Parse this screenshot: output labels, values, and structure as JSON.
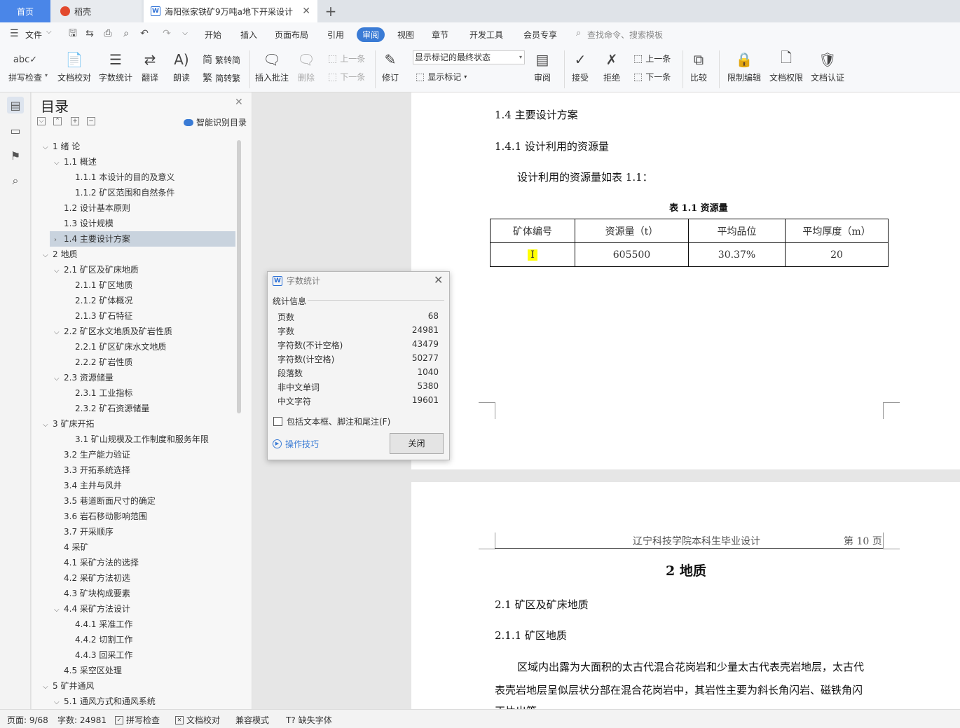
{
  "tabs": {
    "home": "首页",
    "daoke": "稻壳",
    "doc": "海阳张家铁矿9万吨a地下开采设计"
  },
  "menu": {
    "file": "文件",
    "items": [
      "开始",
      "插入",
      "页面布局",
      "引用",
      "审阅",
      "视图",
      "章节",
      "开发工具",
      "会员专享"
    ],
    "search": "查找命令、搜索模板"
  },
  "ribbon": {
    "spellcheck": "拼写检查",
    "doc_check": "文档校对",
    "word_count": "字数统计",
    "translate": "翻译",
    "read_aloud": "朗读",
    "trad": "繁转简",
    "simp": "简转繁",
    "insert_comment": "插入批注",
    "delete": "删除",
    "prev_comment": "上一条",
    "next_comment": "下一条",
    "revise": "修订",
    "markup_state": "显示标记的最终状态",
    "show_markup": "显示标记",
    "review": "审阅",
    "accept": "接受",
    "reject": "拒绝",
    "prev_change": "上一条",
    "next_change": "下一条",
    "compare": "比较",
    "restrict": "限制编辑",
    "permission": "文档权限",
    "certify": "文档认证"
  },
  "toc": {
    "title": "目录",
    "smart": "智能识别目录",
    "items": [
      {
        "label": "1  绪    论",
        "level": 0,
        "arrow": "down"
      },
      {
        "label": "1.1  概述",
        "level": 1,
        "arrow": "down"
      },
      {
        "label": "1.1.1  本设计的目的及意义",
        "level": 2,
        "arrow": ""
      },
      {
        "label": "1.1.2  矿区范围和自然条件",
        "level": 2,
        "arrow": ""
      },
      {
        "label": "1.2  设计基本原则",
        "level": 1,
        "arrow": ""
      },
      {
        "label": "1.3  设计规模",
        "level": 1,
        "arrow": ""
      },
      {
        "label": "1.4  主要设计方案",
        "level": 1,
        "arrow": "right",
        "selected": true
      },
      {
        "label": "2  地质",
        "level": 0,
        "arrow": "down"
      },
      {
        "label": "2.1  矿区及矿床地质",
        "level": 1,
        "arrow": "down"
      },
      {
        "label": "2.1.1  矿区地质",
        "level": 2,
        "arrow": ""
      },
      {
        "label": "2.1.2  矿体概况",
        "level": 2,
        "arrow": ""
      },
      {
        "label": "2.1.3  矿石特征",
        "level": 2,
        "arrow": ""
      },
      {
        "label": "2.2  矿区水文地质及矿岩性质",
        "level": 1,
        "arrow": "down"
      },
      {
        "label": "2.2.1  矿区矿床水文地质",
        "level": 2,
        "arrow": ""
      },
      {
        "label": "2.2.2  矿岩性质",
        "level": 2,
        "arrow": ""
      },
      {
        "label": "2.3  资源储量",
        "level": 1,
        "arrow": "down"
      },
      {
        "label": "2.3.1  工业指标",
        "level": 2,
        "arrow": ""
      },
      {
        "label": "2.3.2  矿石资源储量",
        "level": 2,
        "arrow": ""
      },
      {
        "label": "3  矿床开拓",
        "level": 0,
        "arrow": "down"
      },
      {
        "label": "3.1  矿山规模及工作制度和服务年限",
        "level": 2,
        "arrow": ""
      },
      {
        "label": "3.2  生产能力验证",
        "level": 1,
        "arrow": ""
      },
      {
        "label": "3.3  开拓系统选择",
        "level": 1,
        "arrow": ""
      },
      {
        "label": "3.4  主井与风井",
        "level": 1,
        "arrow": ""
      },
      {
        "label": "3.5  巷道断面尺寸的确定",
        "level": 1,
        "arrow": ""
      },
      {
        "label": "3.6  岩石移动影响范围",
        "level": 1,
        "arrow": ""
      },
      {
        "label": "3.7  开采顺序",
        "level": 1,
        "arrow": ""
      },
      {
        "label": "4  采矿",
        "level": 1,
        "arrow": ""
      },
      {
        "label": "4.1  采矿方法的选择",
        "level": 1,
        "arrow": ""
      },
      {
        "label": "4.2  采矿方法初选",
        "level": 1,
        "arrow": ""
      },
      {
        "label": "4.3  矿块构成要素",
        "level": 1,
        "arrow": ""
      },
      {
        "label": "4.4  采矿方法设计",
        "level": 1,
        "arrow": "down"
      },
      {
        "label": "4.4.1  采准工作",
        "level": 2,
        "arrow": ""
      },
      {
        "label": "4.4.2  切割工作",
        "level": 2,
        "arrow": ""
      },
      {
        "label": "4.4.3  回采工作",
        "level": 2,
        "arrow": ""
      },
      {
        "label": "4.5  采空区处理",
        "level": 1,
        "arrow": ""
      },
      {
        "label": "5  矿井通风",
        "level": 0,
        "arrow": "down"
      },
      {
        "label": "5.1  通风方式和通风系统",
        "level": 1,
        "arrow": "down"
      }
    ]
  },
  "page1": {
    "h1_4": "1.4  主要设计方案",
    "h1_4_1": "1.4.1  设计利用的资源量",
    "para": "设计利用的资源量如表 1.1：",
    "table_caption": "表 1.1  资源量",
    "table_headers": [
      "矿体编号",
      "资源量（t）",
      "平均品位",
      "平均厚度（m）"
    ],
    "table_row": [
      "Ⅰ",
      "605500",
      "30.37%",
      "20"
    ]
  },
  "page2": {
    "header_left": "辽宁科技学院本科生毕业设计",
    "header_right": "第  10  页",
    "chapter": "2  地质",
    "h2_1": "2.1  矿区及矿床地质",
    "h2_1_1": "2.1.1  矿区地质",
    "para_line1": "区域内出露为大面积的太古代混合花岗岩和少量太古代表壳岩地层，太古代",
    "para_line2": "表壳岩地层呈似层状分部在混合花岗岩中，其岩性主要为斜长角闪岩、磁铁角闪",
    "para_line3": "正片出等"
  },
  "dialog": {
    "title": "字数统计",
    "group": "统计信息",
    "stats": [
      {
        "label": "页数",
        "value": "68"
      },
      {
        "label": "字数",
        "value": "24981"
      },
      {
        "label": "字符数(不计空格)",
        "value": "43479"
      },
      {
        "label": "字符数(计空格)",
        "value": "50277"
      },
      {
        "label": "段落数",
        "value": "1040"
      },
      {
        "label": "非中文单词",
        "value": "5380"
      },
      {
        "label": "中文字符",
        "value": "19601"
      }
    ],
    "checkbox": "包括文本框、脚注和尾注(F)",
    "tips": "操作技巧",
    "close": "关闭"
  },
  "status": {
    "page": "页面: 9/68",
    "words": "字数: 24981",
    "spell": "拼写检查",
    "doccheck": "文档校对",
    "compat": "兼容模式",
    "missing_font": "缺失字体"
  }
}
